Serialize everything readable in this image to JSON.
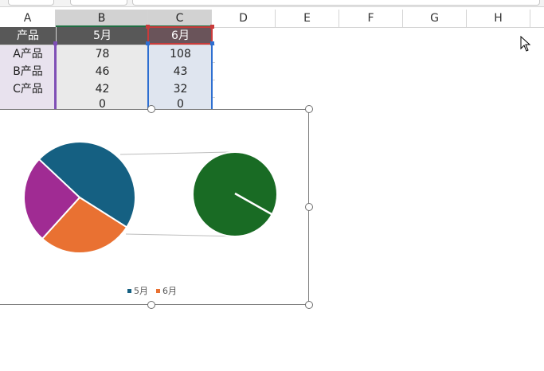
{
  "columns": [
    "A",
    "B",
    "C",
    "D",
    "E",
    "F",
    "G",
    "H"
  ],
  "table": {
    "header": [
      "产品",
      "5月",
      "6月"
    ],
    "rows": [
      [
        "A产品",
        "78",
        "108"
      ],
      [
        "B产品",
        "46",
        "43"
      ],
      [
        "C产品",
        "42",
        "32"
      ],
      [
        "",
        "0",
        "0"
      ]
    ]
  },
  "chart_data": {
    "type": "pie",
    "categories": [
      "A产品",
      "B产品",
      "C产品"
    ],
    "series": [
      {
        "name": "5月",
        "values": [
          78,
          46,
          42
        ],
        "color": "#156082"
      },
      {
        "name": "6月",
        "values": [
          108,
          43,
          32
        ],
        "color": "#e97132"
      }
    ],
    "slice_colors": [
      "#156082",
      "#e97132",
      "#a02b93"
    ],
    "secondary_color": "#196b24",
    "legend_position": "bottom"
  },
  "legend": [
    {
      "label": "5月",
      "color": "#156082"
    },
    {
      "label": "6月",
      "color": "#e97132"
    }
  ]
}
